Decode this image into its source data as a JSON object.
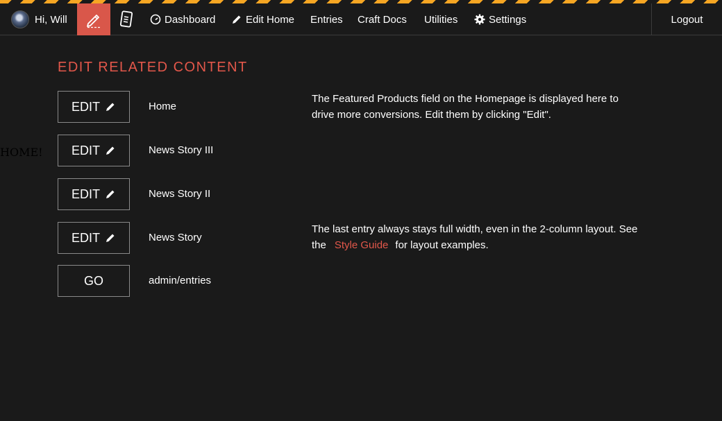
{
  "nav": {
    "greeting": "Hi, Will",
    "links": {
      "dashboard": "Dashboard",
      "edit_home": "Edit Home",
      "entries": "Entries",
      "craft_docs": "Craft Docs",
      "utilities": "Utilities",
      "settings": "Settings"
    },
    "logout": "Logout",
    "active_color": "#d9574a",
    "stripe_color": "#f6a623"
  },
  "side_text": "HOME!",
  "section": {
    "title": "EDIT RELATED CONTENT",
    "accent_color": "#e2574a"
  },
  "rows": [
    {
      "button": "EDIT",
      "label": "Home"
    },
    {
      "button": "EDIT",
      "label": "News Story III"
    },
    {
      "button": "EDIT",
      "label": "News Story II"
    },
    {
      "button": "EDIT",
      "label": "News Story"
    },
    {
      "button": "GO",
      "label": "admin/entries"
    }
  ],
  "notes": {
    "featured": "The Featured Products field on the Homepage is displayed here to drive more conversions. Edit them by clicking \"Edit\".",
    "layout_before": "The last entry always stays full width, even in the 2-column layout. See the",
    "layout_link": "Style Guide",
    "layout_after": "for layout examples."
  }
}
